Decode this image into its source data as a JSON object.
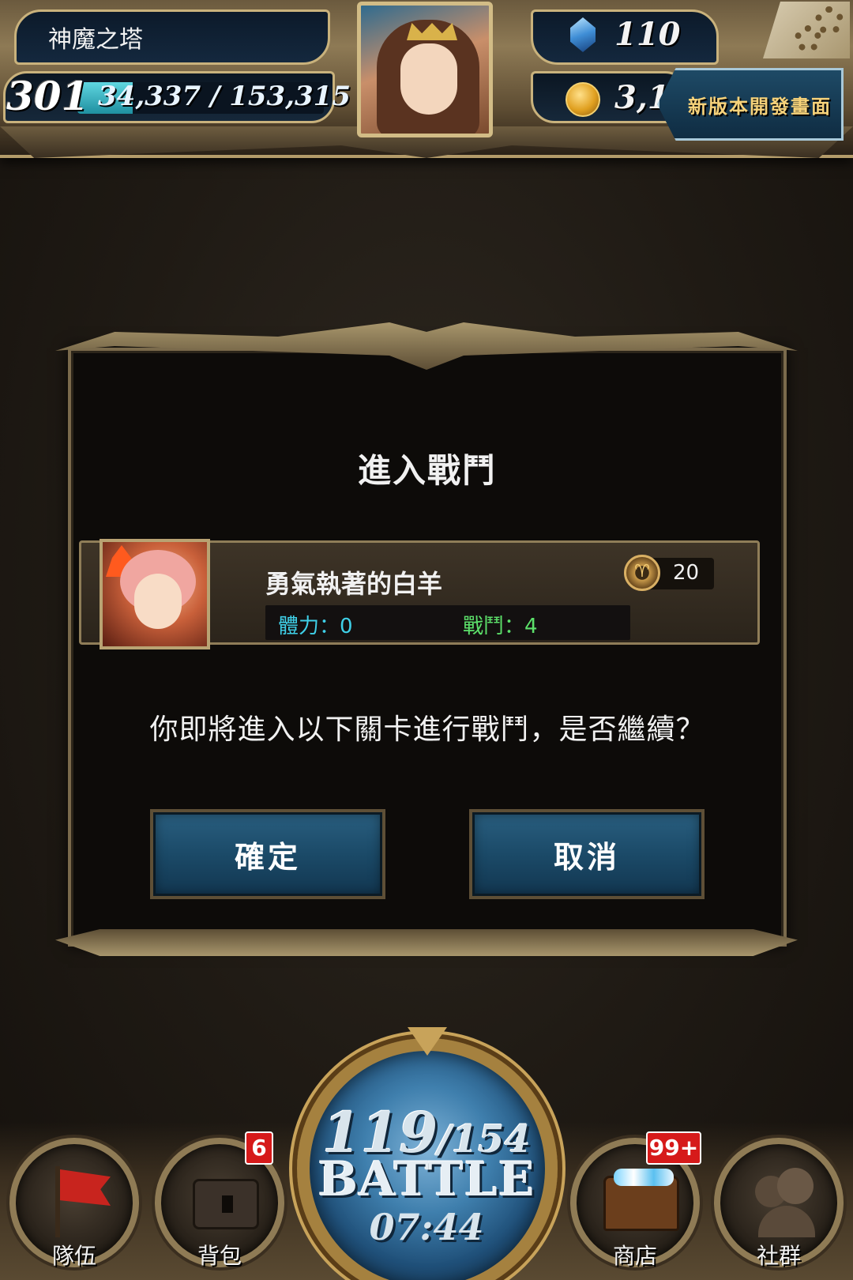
{
  "header": {
    "stage_name": "神魔之塔",
    "level": "301",
    "exp_text": "34,337 / 153,315",
    "exp_progress": 0.224,
    "gems": "110",
    "coins": "3,1",
    "dev_banner": "新版本開發畫面"
  },
  "dialog": {
    "title": "進入戰鬥",
    "stage": {
      "name": "勇氣執著的白羊",
      "level": "20",
      "stamina": "體力：0",
      "battles": "戰鬥：4"
    },
    "message": "你即將進入以下關卡進行戰鬥，是否繼續？",
    "confirm_label": "確定",
    "cancel_label": "取消"
  },
  "bottom_nav": {
    "team": "隊伍",
    "bag": "背包",
    "bag_badge": "6",
    "shop": "商店",
    "shop_badge": "99+",
    "social": "社群"
  },
  "battle": {
    "stamina_current": "119",
    "stamina_max": "/154",
    "label": "BATTLE",
    "timer": "07:44"
  },
  "colors": {
    "stamina_text": "#3fd0e8",
    "battle_text": "#5ce06a",
    "badge": "#d61a1a",
    "button_blue": "#1b4a68"
  },
  "icons": [
    "gem-icon",
    "coin-icon",
    "gear-icon",
    "aries-icon",
    "flag-icon",
    "bag-icon",
    "chest-icon",
    "social-icon"
  ]
}
